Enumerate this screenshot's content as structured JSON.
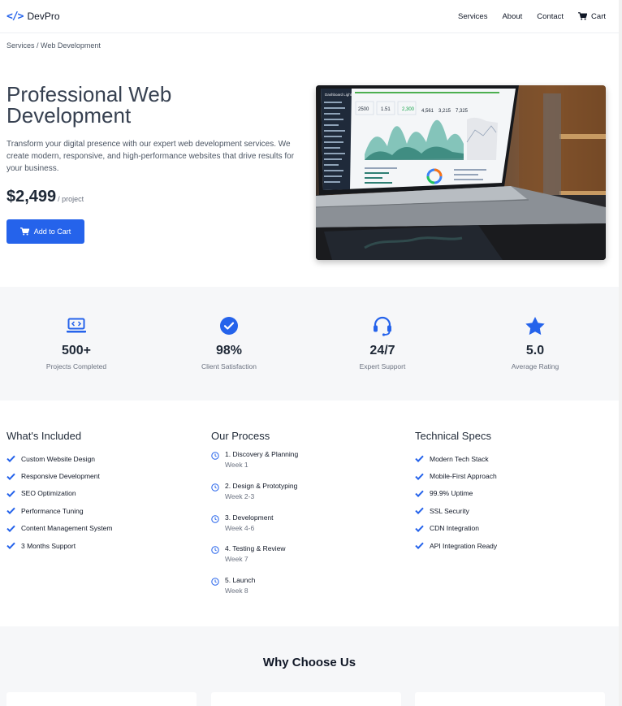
{
  "nav": {
    "brand_code": "</>",
    "brand_name": "DevPro",
    "links": [
      "Services",
      "About",
      "Contact"
    ],
    "cart_label": "Cart"
  },
  "breadcrumb": "Services / Web Development",
  "hero": {
    "title": "Professional Web Development",
    "description": "Transform your digital presence with our expert web development services. We create modern, responsive, and high-performance websites that drive results for your business.",
    "price": "$2,499",
    "price_unit": "/ project",
    "add_to_cart": "Add to Cart",
    "image_dashboard": {
      "title": "Dashboard Light",
      "kpis": [
        "2500",
        "1.51",
        "2,300",
        "4,561",
        "3,215",
        "7,325"
      ]
    }
  },
  "stats": [
    {
      "icon": "laptop-code-icon",
      "value": "500+",
      "label": "Projects Completed"
    },
    {
      "icon": "check-circle-icon",
      "value": "98%",
      "label": "Client Satisfaction"
    },
    {
      "icon": "headset-icon",
      "value": "24/7",
      "label": "Expert Support"
    },
    {
      "icon": "star-icon",
      "value": "5.0",
      "label": "Average Rating"
    }
  ],
  "included": {
    "title": "What's Included",
    "items": [
      "Custom Website Design",
      "Responsive Development",
      "SEO Optimization",
      "Performance Tuning",
      "Content Management System",
      "3 Months Support"
    ]
  },
  "process": {
    "title": "Our Process",
    "steps": [
      {
        "title": "1. Discovery & Planning",
        "week": "Week 1"
      },
      {
        "title": "2. Design & Prototyping",
        "week": "Week 2-3"
      },
      {
        "title": "3. Development",
        "week": "Week 4-6"
      },
      {
        "title": "4. Testing & Review",
        "week": "Week 7"
      },
      {
        "title": "5. Launch",
        "week": "Week 8"
      }
    ]
  },
  "specs": {
    "title": "Technical Specs",
    "items": [
      "Modern Tech Stack",
      "Mobile-First Approach",
      "99.9% Uptime",
      "SSL Security",
      "CDN Integration",
      "API Integration Ready"
    ]
  },
  "why": {
    "title": "Why Choose Us"
  },
  "colors": {
    "accent": "#2563eb",
    "section_bg": "#f6f7f9"
  }
}
